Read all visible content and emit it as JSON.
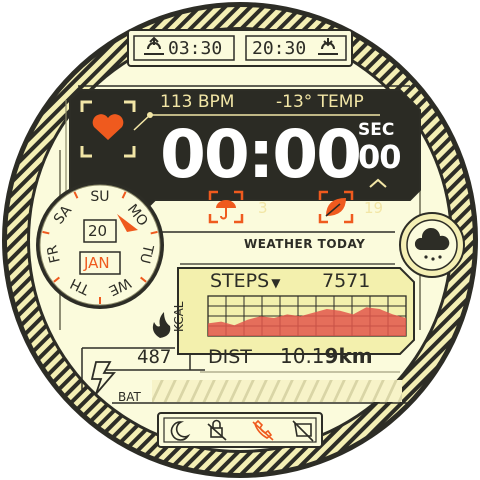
{
  "sun_times": {
    "sunrise": "03:30",
    "sunset": "20:30",
    "sunrise_icon": "sunrise-icon",
    "sunset_icon": "sunset-icon"
  },
  "top_panel": {
    "heart_rate": "113 BPM",
    "temperature": "-13° TEMP",
    "time": "00:00",
    "seconds_label": "SEC",
    "seconds": "00",
    "umbrella_value": "3",
    "leaf_value": "19"
  },
  "date": {
    "days": [
      "SU",
      "MO",
      "TU",
      "WE",
      "TH",
      "FR",
      "SA"
    ],
    "day_number": "20",
    "month": "JAN"
  },
  "weather": {
    "label": "WEATHER TODAY",
    "icon": "cloud-rain-icon"
  },
  "steps": {
    "label": "STEPS",
    "value": "7571",
    "kcal_label": "KCAL",
    "chart_values": [
      0.35,
      0.4,
      0.3,
      0.45,
      0.55,
      0.5,
      0.6,
      0.55,
      0.65,
      0.75,
      0.7,
      0.6,
      0.8,
      0.75,
      0.6,
      0.5
    ]
  },
  "bottom": {
    "kcal_value": "487",
    "dist_label": "DIST",
    "dist_value": "10.1",
    "dist_suffix": "9km",
    "bat_label": "BAT"
  },
  "status_icons": [
    "moon-icon",
    "lock-icon",
    "no-phone-icon",
    "dnd-icon"
  ],
  "colors": {
    "accent": "#ef5a1e",
    "panel_dark": "#2b2b24",
    "cream": "#fbfbd8",
    "frame_yellow": "#f4efa8"
  }
}
